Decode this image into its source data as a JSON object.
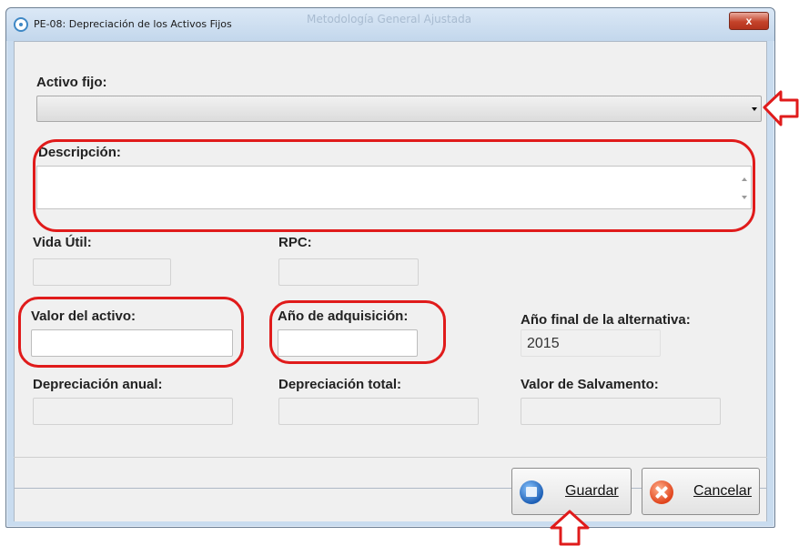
{
  "window": {
    "title": "PE-08: Depreciación de los Activos Fijos",
    "background_title": "Metodología General Ajustada",
    "close_label": "x"
  },
  "form": {
    "activo_fijo_label": "Activo fijo:",
    "descripcion_label": "Descripción:",
    "vida_util_label": "Vida Útil:",
    "rpc_label": "RPC:",
    "valor_activo_label": "Valor del activo:",
    "anio_adquisicion_label": "Año de adquisición:",
    "anio_final_label": "Año final de la alternativa:",
    "anio_final_value": "2015",
    "depreciacion_anual_label": "Depreciación anual:",
    "depreciacion_total_label": "Depreciación total:",
    "valor_salvamento_label": "Valor de Salvamento:"
  },
  "buttons": {
    "guardar": "Guardar",
    "cancelar": "Cancelar"
  },
  "colors": {
    "annotation": "#e01b1b",
    "title_bar": "#c9dcef",
    "panel": "#f0f0f0"
  },
  "icons": {
    "title": "window-icon",
    "save": "save-disk-icon",
    "cancel": "cancel-x-icon"
  }
}
